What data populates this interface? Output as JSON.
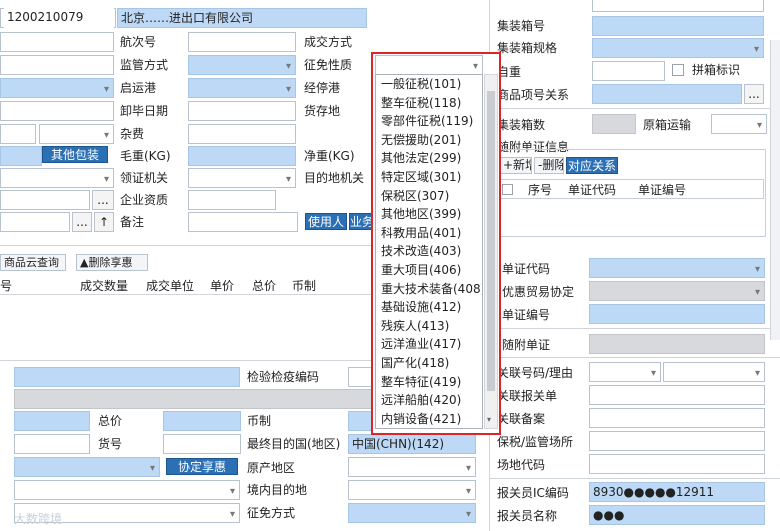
{
  "top": {
    "code": "1200210079",
    "company": "北京……进出口有限公司"
  },
  "left_labels": {
    "voyage": "航次号",
    "supervision": "监管方式",
    "departure_port": "启运港",
    "unload_date": "卸毕日期",
    "misc_fee": "杂费",
    "gross_weight": "毛重(KG)",
    "entry_office": "领证机关",
    "enterprise_qual": "企业资质",
    "remarks": "备注"
  },
  "mid_labels": {
    "deal_mode": "成交方式",
    "exemption": "征免性质",
    "via_port": "经停港",
    "goods_location": "货存地",
    "net_weight": "净重(KG)",
    "dest_office": "目的地机关"
  },
  "buttons": {
    "other_pkg": "其他包装",
    "use_person": "使用人",
    "business": "业务",
    "cloud_query": "商品云查询",
    "delete_share": "▲删除享惠",
    "agree_share": "协定享惠",
    "add": "+新增",
    "delete": "-删除",
    "relation": "对应关系",
    "browse1": "...",
    "browse2": "...",
    "up": "↑"
  },
  "goods_table": {
    "columns": [
      "号",
      "成交数量",
      "成交单位",
      "单价",
      "总价",
      "币制"
    ]
  },
  "bottom_labels": {
    "inspection_code": "检验检疫编码",
    "total_price": "总价",
    "currency": "币制",
    "goods_no": "货号",
    "final_country": "最终目的国(地区)",
    "origin_region": "原产地区",
    "domestic_dest": "境内目的地",
    "exemption_method": "征免方式"
  },
  "bottom_values": {
    "final_country": "中国(CHN)(142)"
  },
  "right_labels": {
    "container_no": "集装箱号",
    "container_spec": "集装箱规格",
    "self_weight": "自重",
    "lcl_flag": "拼箱标识",
    "item_relation": "商品项号关系",
    "container_count": "集装箱数",
    "original_transport": "原箱运输",
    "attach_info": "随附单证信息",
    "attach_code": "单证代码",
    "pref_agreement": "优惠贸易协定",
    "attach_no": "单证编号",
    "attach_doc": "随附单证",
    "related_no": "关联号码/理由",
    "related_decl": "关联报关单",
    "related_record": "关联备案",
    "bonded_place": "保税/监管场所",
    "yard_code": "场地代码",
    "broker_ic": "报关员IC编码",
    "broker_name": "报关员名称"
  },
  "right_values": {
    "broker_ic": "8930●●●●●12911",
    "broker_name": "●●●"
  },
  "attach_table": {
    "columns": [
      "序号",
      "单证代码",
      "单证编号"
    ]
  },
  "dropdown": {
    "options": [
      "一般征税(101)",
      "整车征税(118)",
      "零部件征税(119)",
      "无偿援助(201)",
      "其他法定(299)",
      "特定区域(301)",
      "保税区(307)",
      "其他地区(399)",
      "科教用品(401)",
      "技术改造(403)",
      "重大项目(406)",
      "重大技术装备(408)",
      "基础设施(412)",
      "残疾人(413)",
      "远洋渔业(417)",
      "国产化(418)",
      "整车特征(419)",
      "远洋船舶(420)",
      "内销设备(421)"
    ]
  },
  "watermark": "大数跨境",
  "colors": {
    "required": "#bdd9f5",
    "button": "#2b6fb5",
    "highlight_border": "#d9262b"
  }
}
